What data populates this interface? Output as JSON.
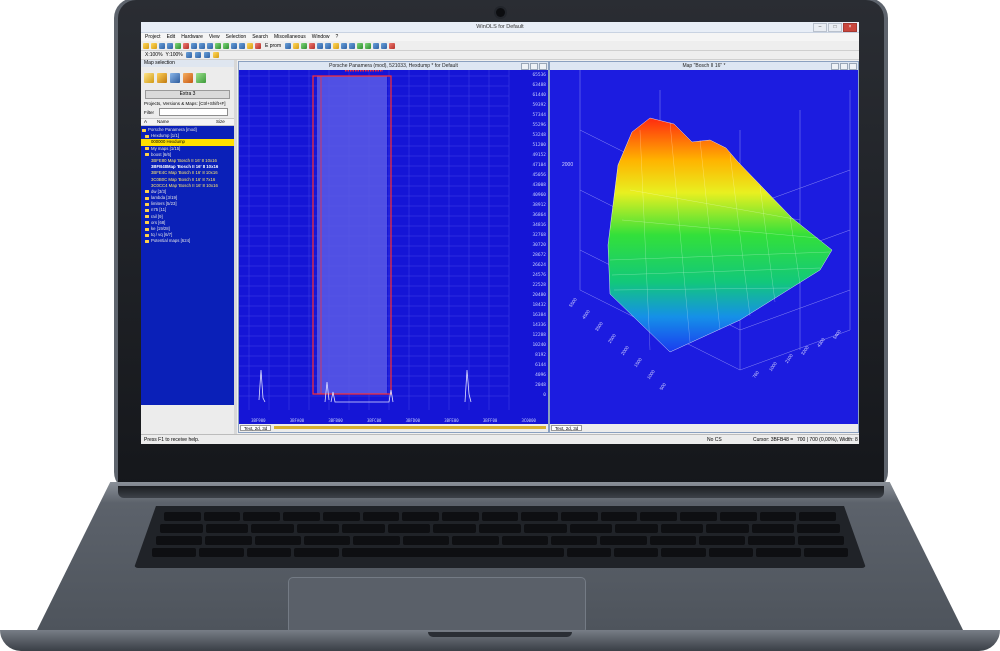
{
  "app": {
    "window_title": "WinOLS for Default",
    "menu": [
      "Project",
      "Edit",
      "Hardware",
      "View",
      "Selection",
      "Search",
      "Miscellaneous",
      "Window",
      "?"
    ],
    "toolbar_text": "E prom",
    "zoom_x": "X:100%",
    "zoom_y": "Y:100%",
    "status_left": "Press F1 to receive help.",
    "status_cs": "No CS",
    "status_cursor": "Cursor: 3BFB48 =",
    "status_values": "700 | 700 (0,00%), Width: 8"
  },
  "left_panel": {
    "title": "Map selection",
    "extra_button": "Extra 3",
    "projects_label": "Projects, Versions & Maps: [Ctrl+Shift+F]",
    "filter_label": "Filter",
    "columns": [
      "A",
      "Name",
      "Size"
    ],
    "tree": [
      {
        "label": "Porsche Panamera [mod]",
        "style": "folder"
      },
      {
        "label": "Hexdump [1/1]",
        "style": "folder"
      },
      {
        "label": "000000 Hexdump",
        "style": "sel"
      },
      {
        "label": "My maps [1/15]",
        "style": "folder"
      },
      {
        "label": "boost [6/6]",
        "style": "folder"
      },
      {
        "label": "3BFE80 Map 'Bosch II 16'   8 10x16",
        "style": "hl"
      },
      {
        "label": "3BFB48Map 'Bosch II 16'   8 10x16",
        "style": "bold"
      },
      {
        "label": "3BFE4C Map 'Bosch II 16'   8 10x16",
        "style": "hl"
      },
      {
        "label": "3C0B0C Map 'Bosch II 16'   8 7x16",
        "style": "hl"
      },
      {
        "label": "3C0CC4 Map 'Bosch II 16'   8 10x16",
        "style": "hl"
      },
      {
        "label": "dw [3/3]",
        "style": "folder"
      },
      {
        "label": "lambda [3/19]",
        "style": "folder"
      },
      {
        "label": "limiters [5/23]",
        "style": "folder"
      },
      {
        "label": "n75 [11]",
        "style": "folder"
      },
      {
        "label": "rail [9]",
        "style": "folder"
      },
      {
        "label": "ors [68]",
        "style": "folder"
      },
      {
        "label": "ke [19/28]",
        "style": "folder"
      },
      {
        "label": "tq / vq [6/7]",
        "style": "folder"
      },
      {
        "label": "Potential maps [624]",
        "style": "folder"
      }
    ]
  },
  "hex_window": {
    "title": "Porsche Panamera (mod), 521033, Hexdump * for Default",
    "y_ticks": [
      "65536",
      "61440",
      "57344",
      "53248",
      "49152",
      "45056",
      "40960",
      "36864",
      "32768",
      "28672",
      "24576",
      "20480",
      "16384",
      "12288",
      "8192",
      "4096",
      "0"
    ],
    "y_ticks_display": [
      "65536",
      "63488",
      "61440",
      "59392",
      "57344",
      "55296",
      "53248",
      "51200",
      "49152",
      "47104",
      "45056",
      "43008",
      "40960",
      "38912",
      "36864",
      "34816",
      "32768",
      "30720",
      "28672",
      "26624",
      "24576",
      "22528",
      "20480",
      "18432",
      "16384",
      "14336",
      "12288",
      "10240",
      "8192",
      "6144",
      "4096",
      "2048",
      "0"
    ],
    "x_ticks": [
      "3BF900",
      "3BFA00",
      "3BFB00",
      "3BFC00",
      "3BFD00",
      "3BFE00",
      "3BFF00",
      "3C0000"
    ],
    "tag": "Text, 2d, 3d"
  },
  "map_window": {
    "title": "Map \"Bosch II 16\" *",
    "z_tick": "2000",
    "axis_rows": [
      "5500",
      "4500",
      "3500",
      "2500",
      "2000",
      "1500",
      "1000",
      "500"
    ],
    "axis_cols": [
      "5400",
      "4300",
      "3200",
      "2100",
      "1000",
      "760"
    ],
    "tag": "Text, 2d, 3d"
  }
}
